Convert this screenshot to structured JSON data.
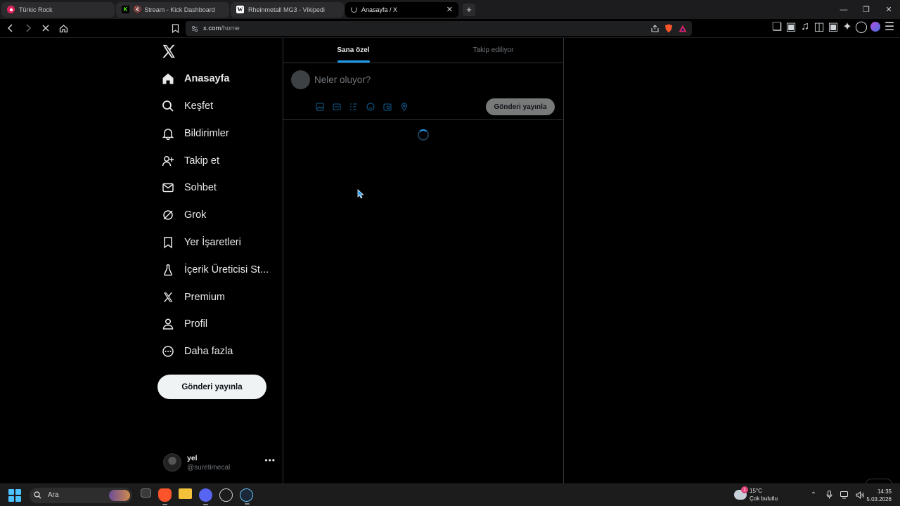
{
  "browser": {
    "tabs": [
      {
        "title": "Türkic Rock",
        "favicon_color": "#e0245e"
      },
      {
        "title": "Stream - Kick Dashboard",
        "favicon_color": "#53fc18",
        "favicon_letter": "K"
      },
      {
        "title": "Rheinmetall MG3 - Vikipedi",
        "favicon_letter": "W"
      },
      {
        "title": "Anasayfa / X",
        "active": true
      }
    ],
    "url_host": "x.com",
    "url_path": "/home"
  },
  "sidebar": {
    "items": [
      {
        "label": "Anasayfa",
        "icon": "home-icon",
        "active": true
      },
      {
        "label": "Keşfet",
        "icon": "search-icon"
      },
      {
        "label": "Bildirimler",
        "icon": "bell-icon"
      },
      {
        "label": "Takip et",
        "icon": "follow-icon"
      },
      {
        "label": "Sohbet",
        "icon": "mail-icon"
      },
      {
        "label": "Grok",
        "icon": "grok-icon"
      },
      {
        "label": "Yer İşaretleri",
        "icon": "bookmark-icon"
      },
      {
        "label": "İçerik Üreticisi St...",
        "icon": "creator-studio-icon"
      },
      {
        "label": "Premium",
        "icon": "x-logo-icon"
      },
      {
        "label": "Profil",
        "icon": "profile-icon"
      },
      {
        "label": "Daha fazla",
        "icon": "more-circle-icon"
      }
    ],
    "post_button": "Gönderi yayınla",
    "account": {
      "name": "yel",
      "handle": "@suretimecal"
    }
  },
  "feed": {
    "tabs": [
      {
        "label": "Sana özel",
        "active": true
      },
      {
        "label": "Takip ediliyor"
      }
    ],
    "composer_placeholder": "Neler oluyor?",
    "composer_post_button": "Gönderi yayınla",
    "loading": true
  },
  "taskbar": {
    "search_placeholder": "Ara",
    "weather_temp": "15°C",
    "weather_desc": "Çok bulutlu",
    "weather_badge": "1",
    "time": "14:35",
    "date": "5.03.2026"
  },
  "colors": {
    "accent": "#1d9bf0",
    "background": "#000000",
    "text": "#e7e9ea",
    "muted": "#71767b"
  }
}
